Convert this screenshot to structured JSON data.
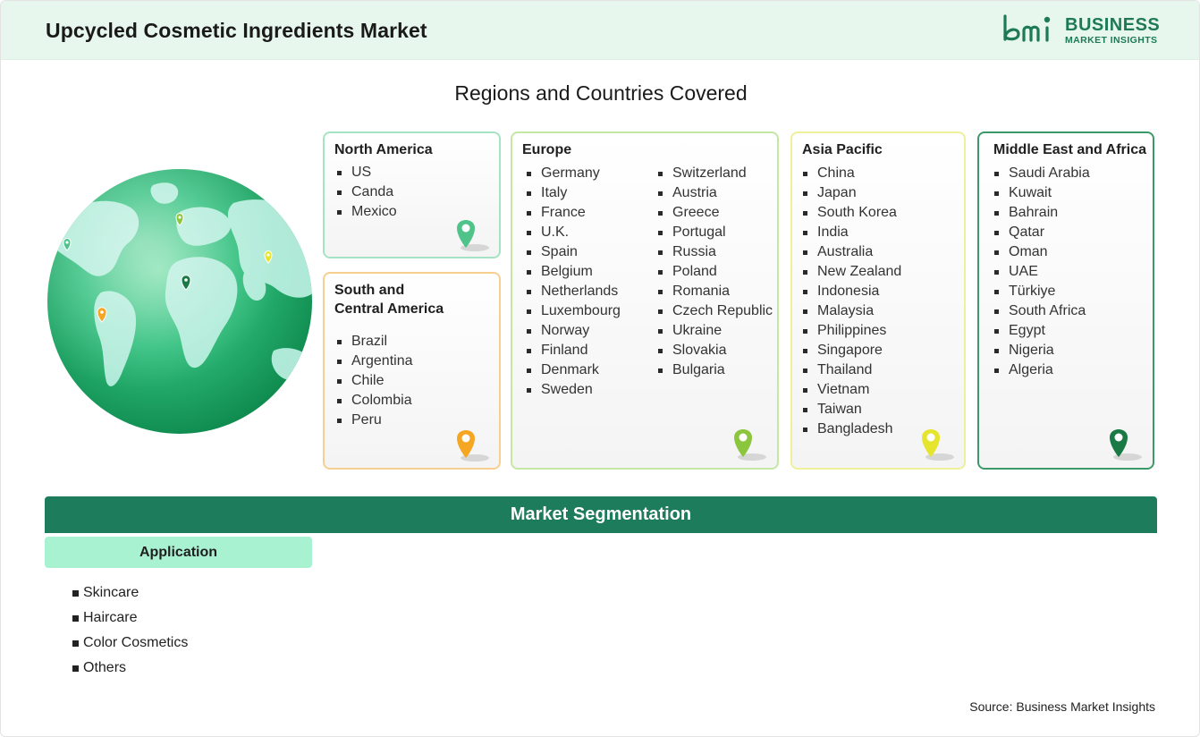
{
  "header": {
    "title": "Upcycled Cosmetic Ingredients Market",
    "logo_line1": "BUSINESS",
    "logo_line2": "MARKET INSIGHTS"
  },
  "section_title": "Regions and Countries Covered",
  "regions": {
    "north_america": {
      "title": "North America",
      "countries": [
        "US",
        "Canda",
        "Mexico"
      ],
      "color": "#4fc38a"
    },
    "south_central_america": {
      "title_line1": "South and",
      "title_line2": "Central America",
      "countries": [
        "Brazil",
        "Argentina",
        "Chile",
        "Colombia",
        "Peru"
      ],
      "color": "#f5a623"
    },
    "europe": {
      "title": "Europe",
      "col1": [
        "Germany",
        "Italy",
        "France",
        "U.K.",
        "Spain",
        "Belgium",
        "Netherlands",
        "Luxembourg",
        "Norway",
        "Finland",
        "Denmark",
        "Sweden"
      ],
      "col2": [
        "Switzerland",
        "Austria",
        "Greece",
        "Portugal",
        "Russia",
        "Poland",
        "Romania",
        "Czech Republic",
        "Ukraine",
        "Slovakia",
        "Bulgaria"
      ],
      "color": "#8cc63f"
    },
    "asia_pacific": {
      "title": "Asia Pacific",
      "countries": [
        "China",
        "Japan",
        "South Korea",
        "India",
        "Australia",
        "New Zealand",
        "Indonesia",
        "Malaysia",
        "Philippines",
        "Singapore",
        "Thailand",
        "Vietnam",
        "Taiwan",
        "Bangladesh"
      ],
      "color": "#e5e52d"
    },
    "middle_east_africa": {
      "title": "Middle East and Africa",
      "countries": [
        "Saudi Arabia",
        "Kuwait",
        "Bahrain",
        "Qatar",
        "Oman",
        "UAE",
        "Türkiye",
        "South Africa",
        "Egypt",
        "Nigeria",
        "Algeria"
      ],
      "color": "#1a7a46"
    }
  },
  "segmentation": {
    "title": "Market Segmentation",
    "application_label": "Application",
    "applications": [
      "Skincare",
      "Haircare",
      "Color Cosmetics",
      "Others"
    ]
  },
  "source": "Source: Business Market Insights"
}
